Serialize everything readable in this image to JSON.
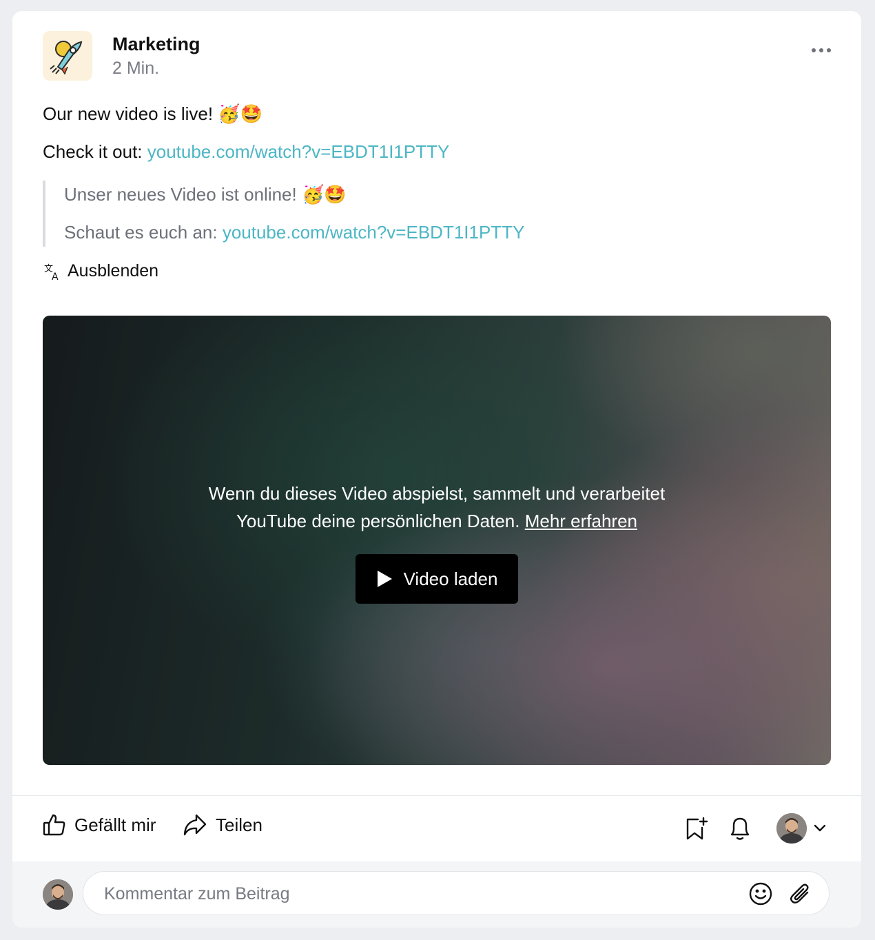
{
  "post": {
    "author": "Marketing",
    "time": "2 Min.",
    "line1": "Our new video is live! 🥳🤩",
    "line2_prefix": "Check it out: ",
    "link": "youtube.com/watch?v=EBDT1I1PTTY",
    "translation": {
      "line1": "Unser neues Video ist online! 🥳🤩",
      "line2_prefix": "Schaut es euch an: ",
      "link": "youtube.com/watch?v=EBDT1I1PTTY"
    },
    "hide_translation_label": "Ausblenden"
  },
  "video": {
    "notice_line1": "Wenn du dieses Video abspielst, sammelt und verarbeitet",
    "notice_line2": "YouTube deine persönlichen Daten.",
    "learn_more": "Mehr erfahren",
    "load_label": "Video laden"
  },
  "actions": {
    "like_label": "Gefällt mir",
    "share_label": "Teilen"
  },
  "comment": {
    "placeholder": "Kommentar zum Beitrag"
  },
  "colors": {
    "link": "#4cb6c4",
    "logo_bg": "#fbf1dc"
  },
  "icons": [
    "rocket-logo-icon",
    "more-dots-icon",
    "translate-icon",
    "play-icon",
    "thumbs-up-icon",
    "share-arrow-icon",
    "bookmark-add-icon",
    "bell-icon",
    "chevron-down-icon",
    "smiley-icon",
    "paperclip-icon"
  ]
}
